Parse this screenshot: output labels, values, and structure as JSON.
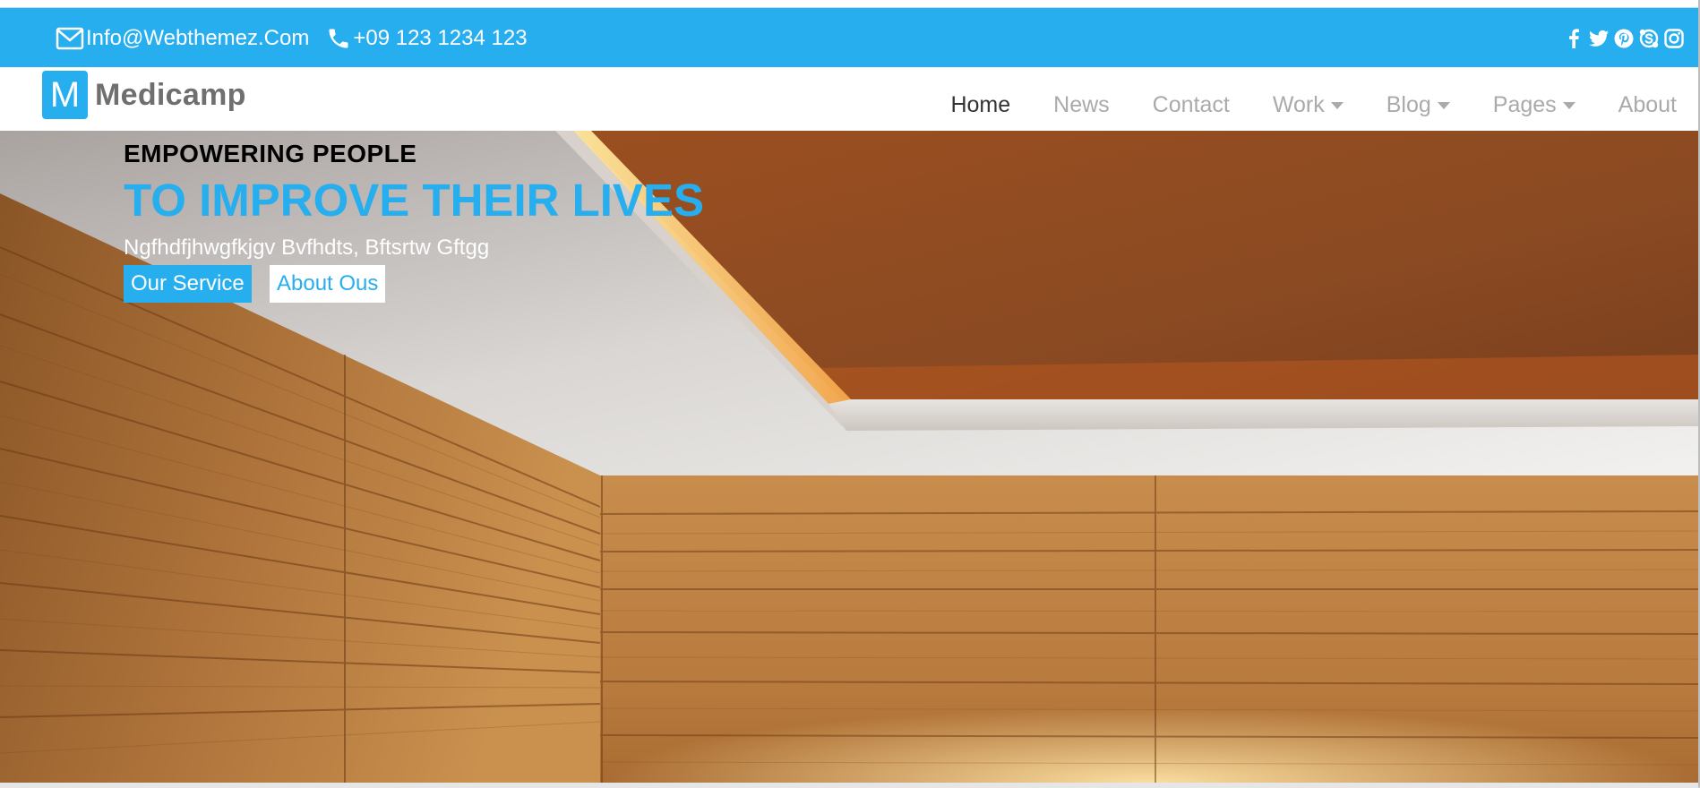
{
  "colors": {
    "accent": "#27aeef",
    "nav_active": "#333333",
    "nav_inactive": "#aaaaaa"
  },
  "topbar": {
    "email": "Info@Webthemez.Com",
    "phone": "+09 123 1234 123",
    "email_icon": "mail-icon",
    "phone_icon": "phone-icon",
    "social_icons": [
      "facebook-icon",
      "twitter-icon",
      "pinterest-icon",
      "skype-icon",
      "instagram-icon"
    ]
  },
  "brand": {
    "logo_letter": "M",
    "name": "Medicamp"
  },
  "nav": {
    "items": [
      {
        "label": "Home",
        "active": true,
        "dropdown": false
      },
      {
        "label": "News",
        "active": false,
        "dropdown": false
      },
      {
        "label": "Contact",
        "active": false,
        "dropdown": false
      },
      {
        "label": "Work",
        "active": false,
        "dropdown": true
      },
      {
        "label": "Blog",
        "active": false,
        "dropdown": true
      },
      {
        "label": "Pages",
        "active": false,
        "dropdown": true
      },
      {
        "label": "About",
        "active": false,
        "dropdown": false
      }
    ]
  },
  "hero": {
    "eyebrow": "EMPOWERING PEOPLE",
    "headline": "TO IMPROVE THEIR LIVES",
    "subline": "Ngfhdfjhwgfkjgv Bvfhdts, Bftsrtw Gftgg",
    "primary_button": "Our Service",
    "secondary_button": "About Ous"
  }
}
